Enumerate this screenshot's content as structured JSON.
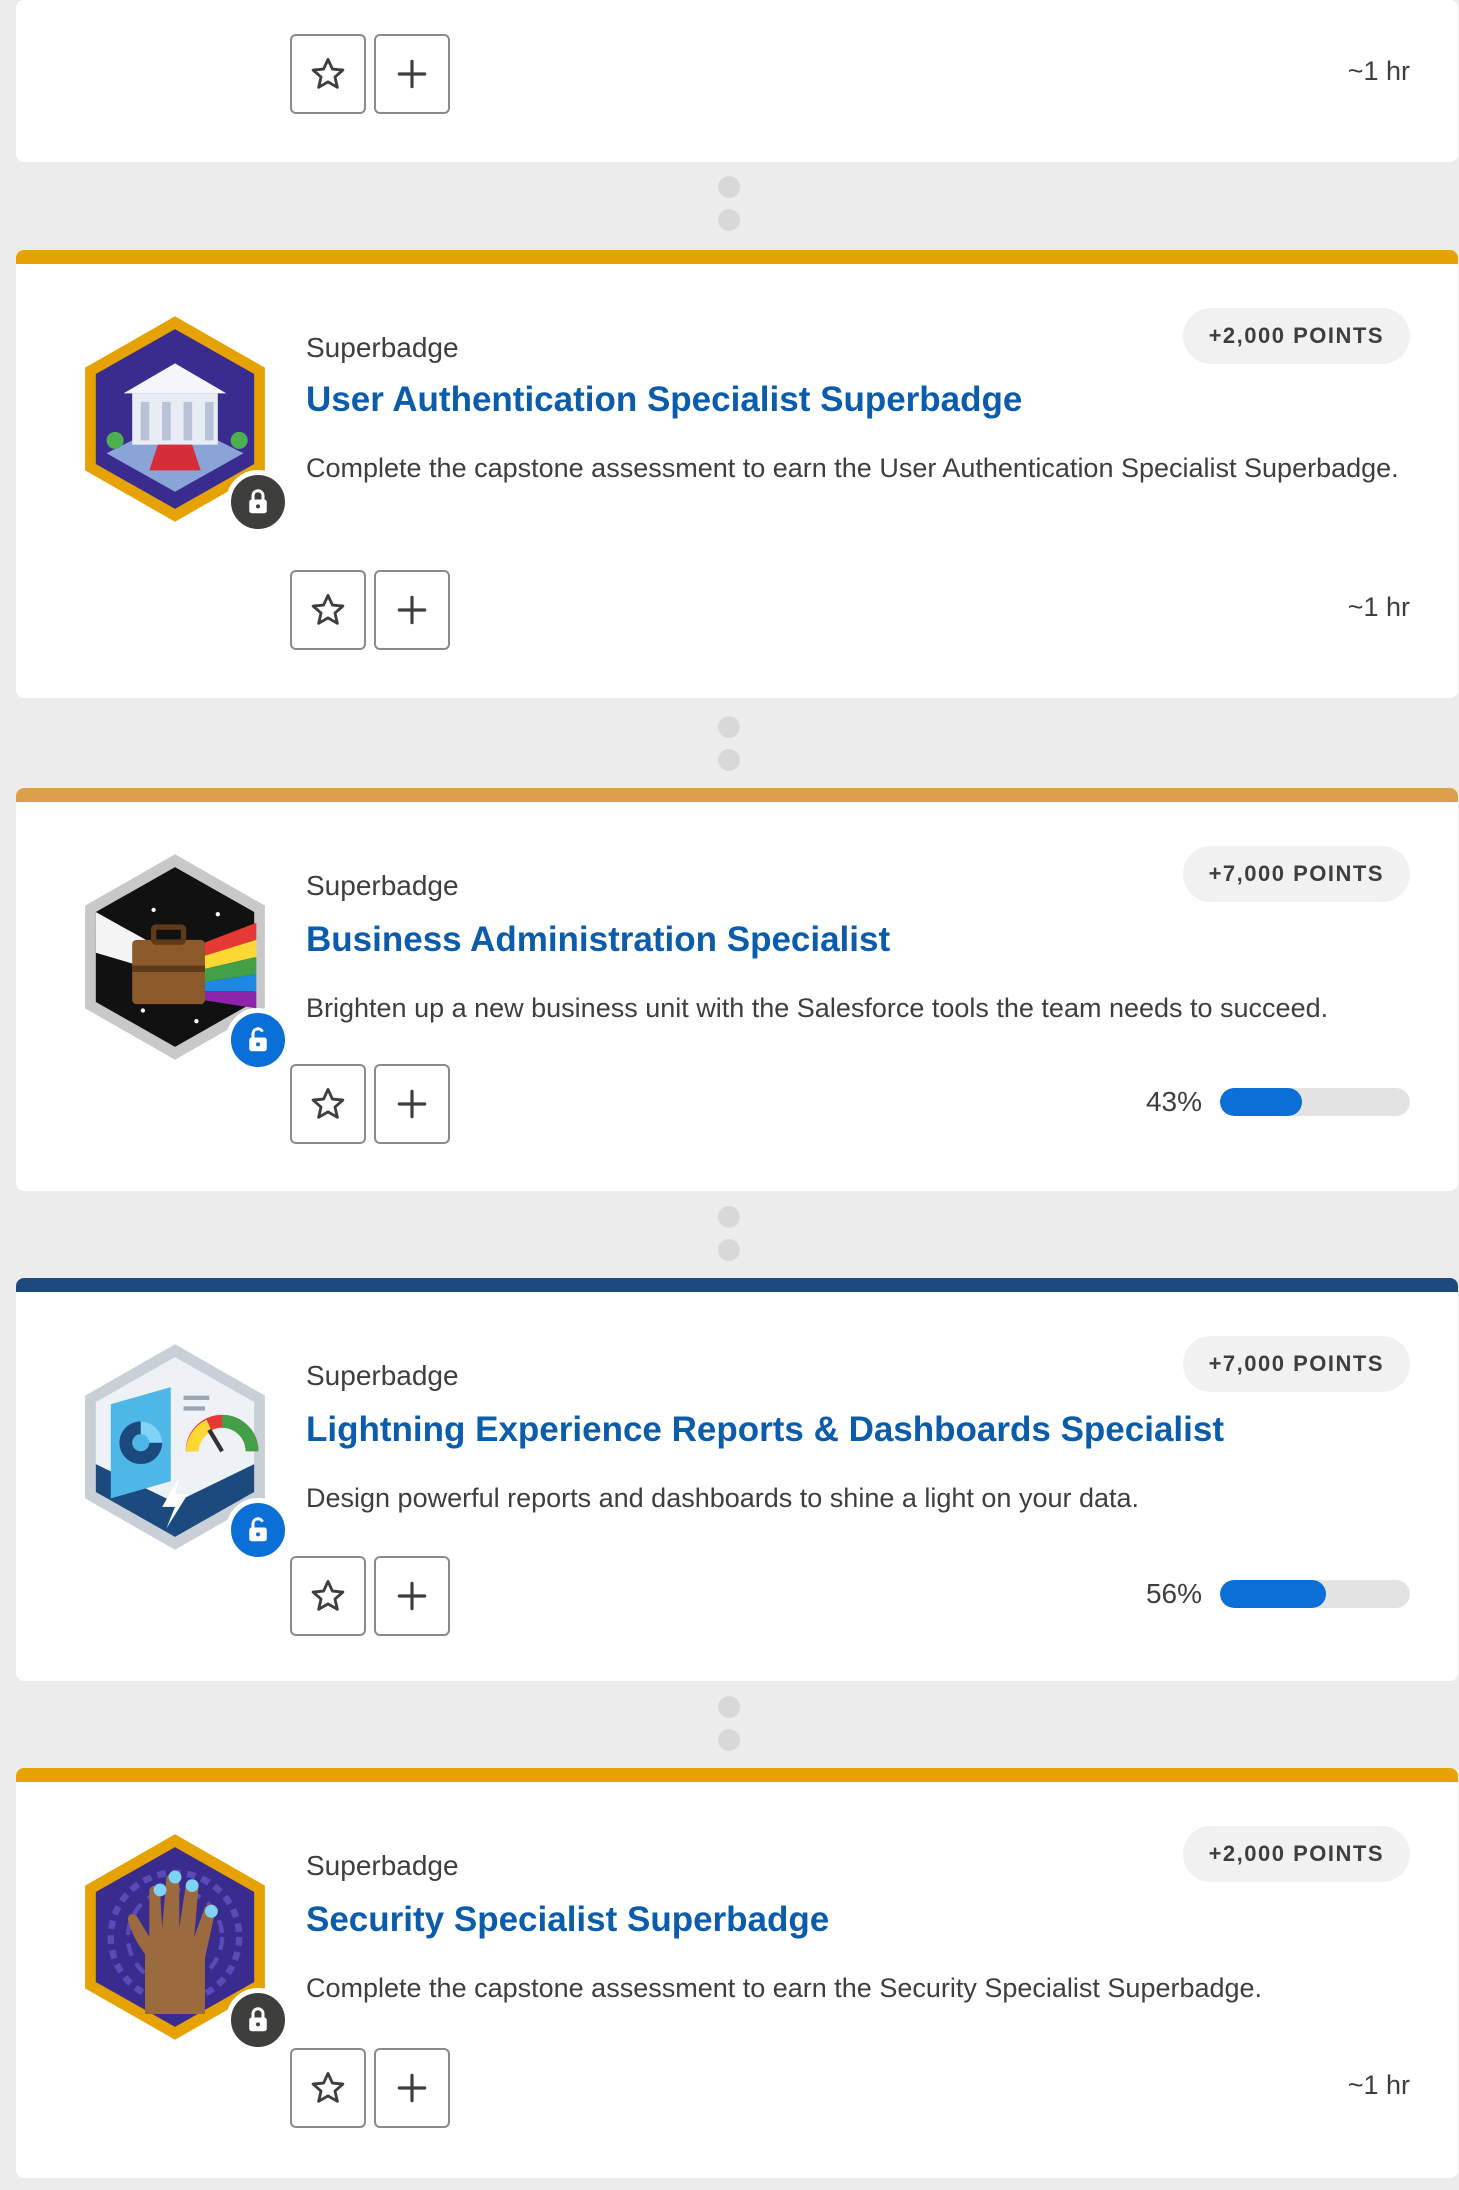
{
  "cards": [
    {
      "id": "partial-top",
      "time": "~1 hr",
      "actions": {
        "favorite": "favorite",
        "add": "add"
      }
    },
    {
      "id": "user-auth",
      "bar_color": "#e5a200",
      "type_label": "Superbadge",
      "title": "User Authentication Specialist Superbadge",
      "description": "Complete the capstone assessment to earn the User Authentication Specialist Superbadge.",
      "points": "+2,000 POINTS",
      "time": "~1 hr",
      "lock_state": "locked",
      "lock_color": "#3e3e3c",
      "badge_icon": "bank-icon"
    },
    {
      "id": "business-admin",
      "bar_color": "#dca04b",
      "type_label": "Superbadge",
      "title": "Business Administration Specialist",
      "description": "Brighten up a new business unit with the Salesforce tools the team needs to succeed.",
      "points": "+7,000 POINTS",
      "progress": {
        "label": "43%",
        "value": 43
      },
      "lock_state": "unlocked",
      "lock_color": "#0b6fd8",
      "badge_icon": "briefcase-prism-icon"
    },
    {
      "id": "lightning-reports",
      "bar_color": "#1d4a7e",
      "type_label": "Superbadge",
      "title": "Lightning Experience Reports & Dashboards Specialist",
      "description": "Design powerful reports and dashboards to shine a light on your data.",
      "points": "+7,000 POINTS",
      "progress": {
        "label": "56%",
        "value": 56
      },
      "lock_state": "unlocked",
      "lock_color": "#0b6fd8",
      "badge_icon": "dashboard-icon"
    },
    {
      "id": "security-specialist",
      "bar_color": "#e5a200",
      "type_label": "Superbadge",
      "title": "Security Specialist Superbadge",
      "description": "Complete the capstone assessment to earn the Security Specialist Superbadge.",
      "points": "+2,000 POINTS",
      "time": "~1 hr",
      "lock_state": "locked",
      "lock_color": "#3e3e3c",
      "badge_icon": "hand-scan-icon"
    }
  ]
}
